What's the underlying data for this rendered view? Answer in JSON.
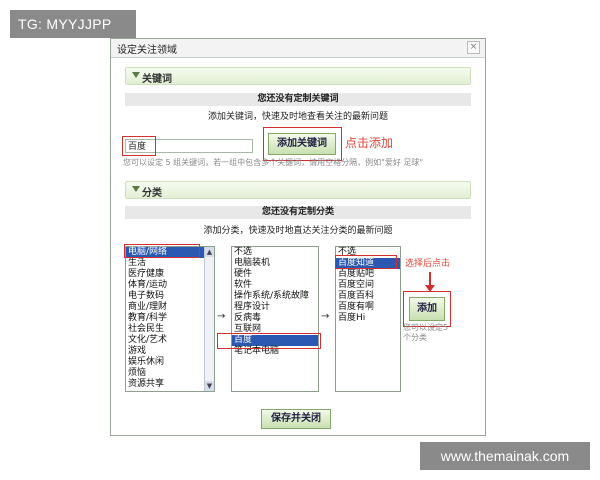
{
  "watermarks": {
    "top": "TG: MYYJJPP",
    "bottom": "www.themainak.com"
  },
  "dialog": {
    "title": "设定关注领域",
    "close_icon": "×"
  },
  "keyword_section": {
    "header": "关键词",
    "status": "您还没有定制关键词",
    "tip": "添加关键词，快速及时地查看关注的最新问题",
    "input_value": "百度",
    "add_button": "添加关键词",
    "annotation": "点击添加",
    "hint": "您可以设定 5 组关键词，若一组中包含多个关键词，请用空格分隔，例如\"爱好 足球\""
  },
  "category_section": {
    "header": "分类",
    "status": "您还没有定制分类",
    "tip": "添加分类，快速及时地直达关注分类的最新问题",
    "list1": {
      "items": [
        "电脑/网络",
        "生活",
        "医疗健康",
        "体育/运动",
        "电子数码",
        "商业/理财",
        "教育/科学",
        "社会民生",
        "文化/艺术",
        "游戏",
        "娱乐休闲",
        "烦恼",
        "资源共享"
      ],
      "selected_index": 0
    },
    "list2": {
      "items": [
        "不选",
        "电脑装机",
        "硬件",
        "软件",
        "操作系统/系统故障",
        "程序设计",
        "反病毒",
        "互联网",
        "百度",
        "笔记本电脑"
      ],
      "selected_index": 8
    },
    "list3": {
      "items": [
        "不选",
        "百度知道",
        "百度贴吧",
        "百度空间",
        "百度百科",
        "百度有啊",
        "百度Hi"
      ],
      "selected_index": 1
    },
    "arrow_glyph": "→",
    "annotation": "选择后点击",
    "add_button": "添加",
    "hint": "您可以设定5个分类"
  },
  "footer": {
    "save_close_button": "保存并关闭"
  },
  "colors": {
    "accent_green": "#86a86a",
    "annotation_red": "#e0463b",
    "selection_blue": "#2b58b0"
  }
}
